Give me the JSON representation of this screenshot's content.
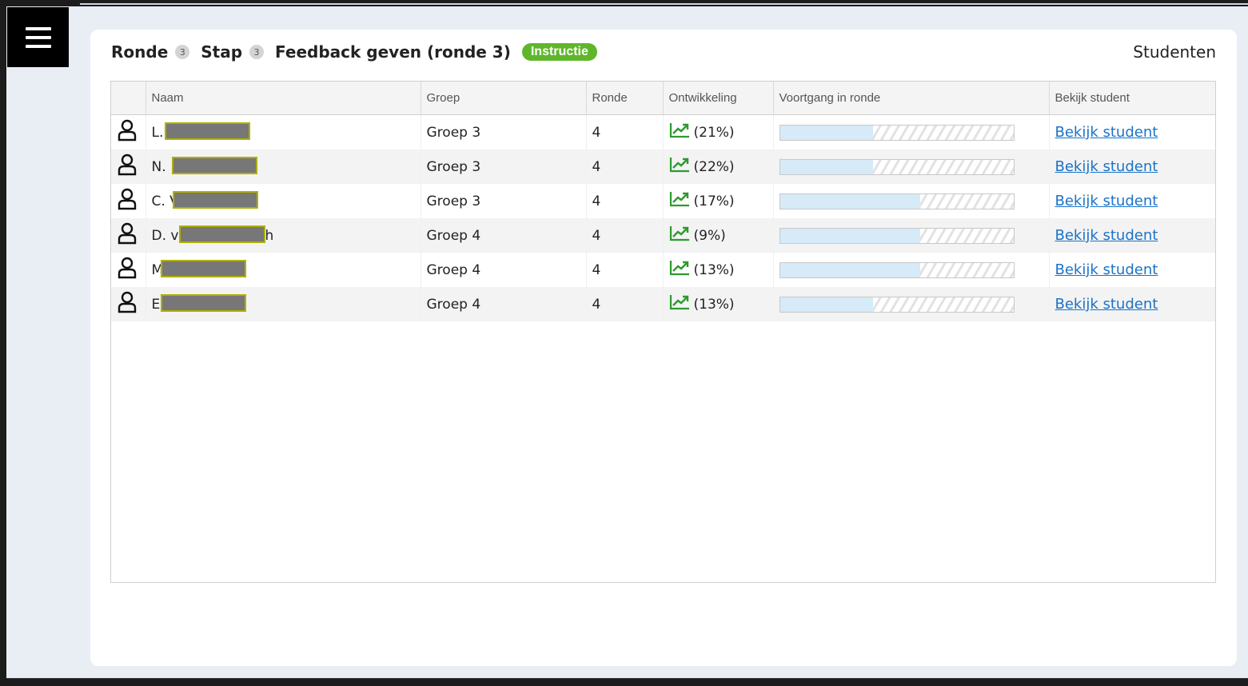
{
  "header": {
    "crumb1_label": "Ronde",
    "crumb1_badge": "3",
    "crumb2_label": "Stap",
    "crumb2_badge": "3",
    "title": "Feedback geven (ronde 3)",
    "instructie_label": "Instructie",
    "right_label": "Studenten"
  },
  "table": {
    "headers": [
      "",
      "Naam",
      "Groep",
      "Ronde",
      "Ontwikkeling",
      "Voortgang in ronde",
      "Bekijk student"
    ],
    "rows": [
      {
        "name_visible": "L.",
        "suffix": "",
        "group": "Groep 3",
        "round": "4",
        "trend": "(21%)",
        "progress": 0.4,
        "link": "Bekijk student"
      },
      {
        "name_visible": "N.",
        "suffix": "",
        "group": "Groep 3",
        "round": "4",
        "trend": "(22%)",
        "progress": 0.4,
        "link": "Bekijk student"
      },
      {
        "name_visible": "C. V",
        "suffix": "",
        "group": "Groep 3",
        "round": "4",
        "trend": "(17%)",
        "progress": 0.6,
        "link": "Bekijk student"
      },
      {
        "name_visible": "D. v",
        "suffix": "h",
        "group": "Groep 4",
        "round": "4",
        "trend": "(9%)",
        "progress": 0.6,
        "link": "Bekijk student"
      },
      {
        "name_visible": "M",
        "suffix": "",
        "group": "Groep 4",
        "round": "4",
        "trend": "(13%)",
        "progress": 0.6,
        "link": "Bekijk student"
      },
      {
        "name_visible": "E.",
        "suffix": "",
        "group": "Groep 4",
        "round": "4",
        "trend": "(13%)",
        "progress": 0.4,
        "link": "Bekijk student"
      }
    ]
  },
  "colors": {
    "instructie": "#5fb62b",
    "trend_icon": "#2e9a2e",
    "link": "#1a73c8",
    "progress_fill": "#d6eaf7"
  },
  "icons": {
    "menu": "hamburger-icon",
    "user": "user-icon",
    "trend": "trend-up-icon"
  }
}
